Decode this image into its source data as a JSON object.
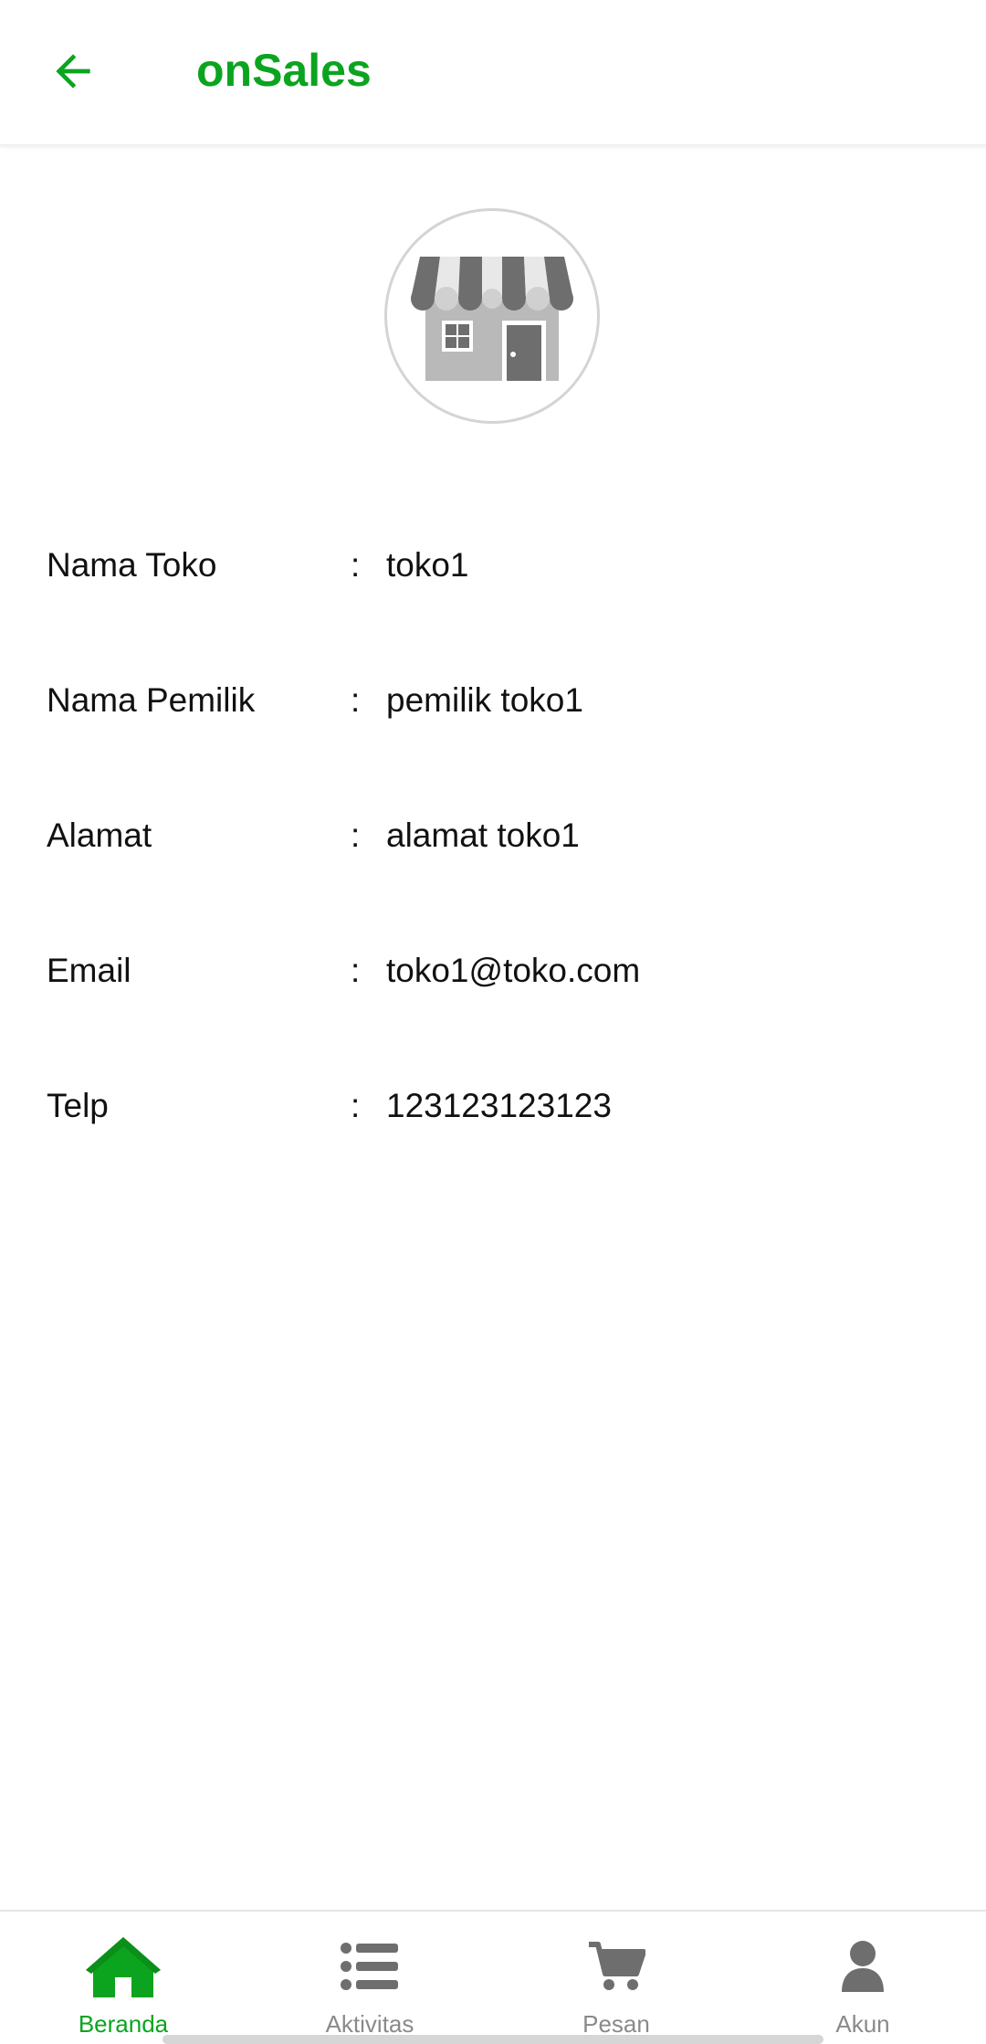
{
  "appbar": {
    "title": "onSales",
    "back_icon": "arrow-left-icon"
  },
  "colors": {
    "brand": "#0ca41f",
    "inactive": "#8a8a8a"
  },
  "store": {
    "avatar_icon": "store-icon",
    "rows": [
      {
        "label": "Nama Toko",
        "colon": ":",
        "value": "toko1"
      },
      {
        "label": "Nama Pemilik",
        "colon": ":",
        "value": "pemilik toko1"
      },
      {
        "label": "Alamat",
        "colon": ":",
        "value": "alamat toko1"
      },
      {
        "label": "Email",
        "colon": ":",
        "value": "toko1@toko.com"
      },
      {
        "label": "Telp",
        "colon": ":",
        "value": "123123123123"
      }
    ]
  },
  "bottom_nav": {
    "items": [
      {
        "label": "Beranda",
        "icon": "home-icon",
        "active": true
      },
      {
        "label": "Aktivitas",
        "icon": "list-icon",
        "active": false
      },
      {
        "label": "Pesan",
        "icon": "cart-icon",
        "active": false
      },
      {
        "label": "Akun",
        "icon": "user-icon",
        "active": false
      }
    ]
  }
}
